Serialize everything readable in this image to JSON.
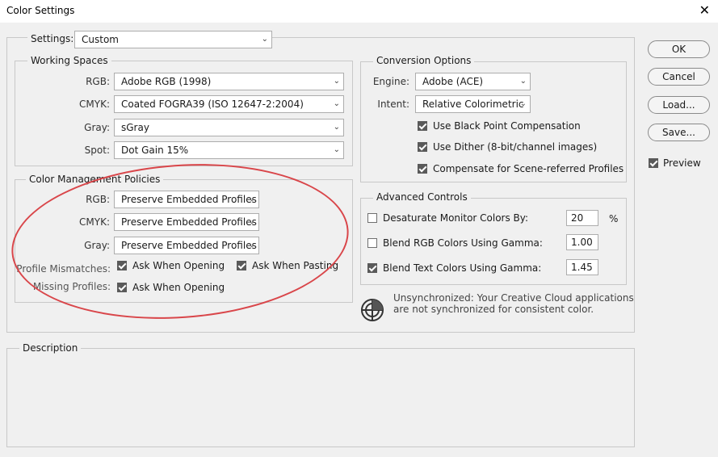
{
  "window": {
    "title": "Color Settings",
    "close_symbol": "✕"
  },
  "settings": {
    "label": "Settings:",
    "value": "Custom"
  },
  "working_spaces": {
    "legend": "Working Spaces",
    "rgb_label": "RGB:",
    "rgb_value": "Adobe RGB (1998)",
    "cmyk_label": "CMYK:",
    "cmyk_value": "Coated FOGRA39 (ISO 12647-2:2004)",
    "gray_label": "Gray:",
    "gray_value": "sGray",
    "spot_label": "Spot:",
    "spot_value": "Dot Gain 15%"
  },
  "policies": {
    "legend": "Color Management Policies",
    "rgb_label": "RGB:",
    "rgb_value": "Preserve Embedded Profiles",
    "cmyk_label": "CMYK:",
    "cmyk_value": "Preserve Embedded Profiles",
    "gray_label": "Gray:",
    "gray_value": "Preserve Embedded Profiles",
    "mismatch_label": "Profile Mismatches:",
    "ask_opening": "Ask When Opening",
    "ask_pasting": "Ask When Pasting",
    "missing_label": "Missing Profiles:",
    "missing_ask_opening": "Ask When Opening"
  },
  "conversion": {
    "legend": "Conversion Options",
    "engine_label": "Engine:",
    "engine_value": "Adobe (ACE)",
    "intent_label": "Intent:",
    "intent_value": "Relative Colorimetric",
    "black_point": "Use Black Point Compensation",
    "dither": "Use Dither (8-bit/channel images)",
    "scene_referred": "Compensate for Scene-referred Profiles"
  },
  "advanced": {
    "legend": "Advanced Controls",
    "desaturate": "Desaturate Monitor Colors By:",
    "desaturate_value": "20",
    "desaturate_unit": "%",
    "blend_rgb": "Blend RGB Colors Using Gamma:",
    "blend_rgb_value": "1.00",
    "blend_text": "Blend Text Colors Using Gamma:",
    "blend_text_value": "1.45"
  },
  "sync_note": {
    "line1": "Unsynchronized: Your Creative Cloud applications",
    "line2": "are not synchronized for consistent color."
  },
  "description": {
    "legend": "Description"
  },
  "buttons": {
    "ok": "OK",
    "cancel": "Cancel",
    "load": "Load...",
    "save": "Save..."
  },
  "preview": {
    "label": "Preview"
  },
  "colors": {
    "annotation": "#d9464a",
    "checkbox_on": "#5a5a5a"
  }
}
